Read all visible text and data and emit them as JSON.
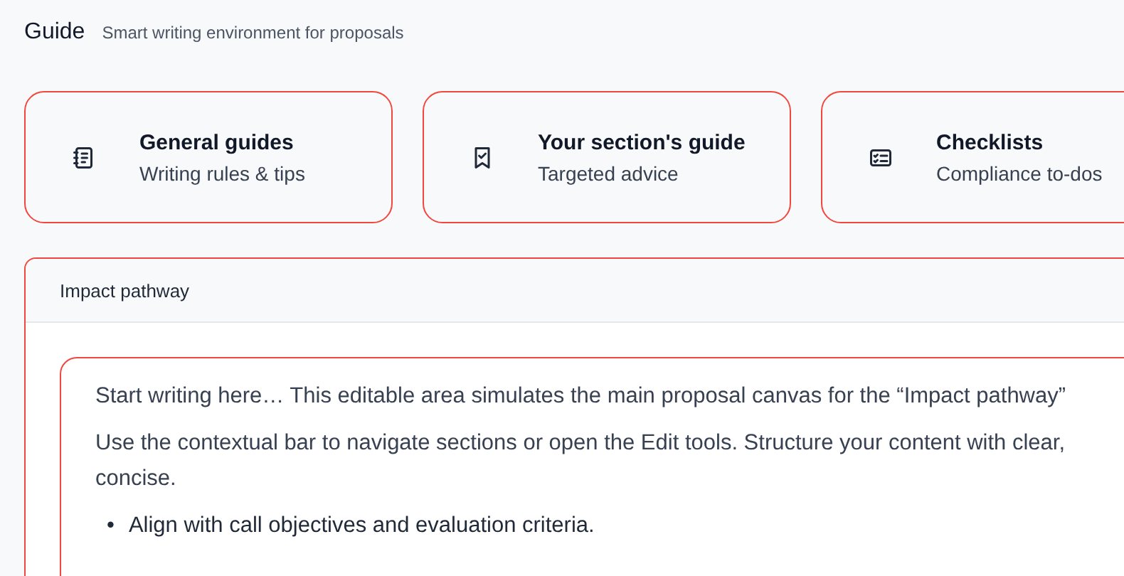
{
  "header": {
    "title": "Guide",
    "subtitle": "Smart writing environment for proposals"
  },
  "cards": [
    {
      "kind": "notebook",
      "title": "General guides",
      "subtitle": "Writing rules & tips"
    },
    {
      "kind": "bookmark",
      "title": "Your section's guide",
      "subtitle": "Targeted advice"
    },
    {
      "kind": "checklist",
      "title": "Checklists",
      "subtitle": "Compliance to-dos"
    }
  ],
  "section": {
    "title": "Impact pathway",
    "paragraphs": [
      [
        "Start writing here… This editable area simulates the main proposal canvas for the “Impact pathway”"
      ],
      [
        "Use the contextual bar to navigate sections or open the Edit tools. Structure your content with clear,",
        "concise."
      ]
    ],
    "bullets": [
      {
        "marker": "•",
        "text": "Align with call objectives and evaluation criteria."
      }
    ]
  }
}
